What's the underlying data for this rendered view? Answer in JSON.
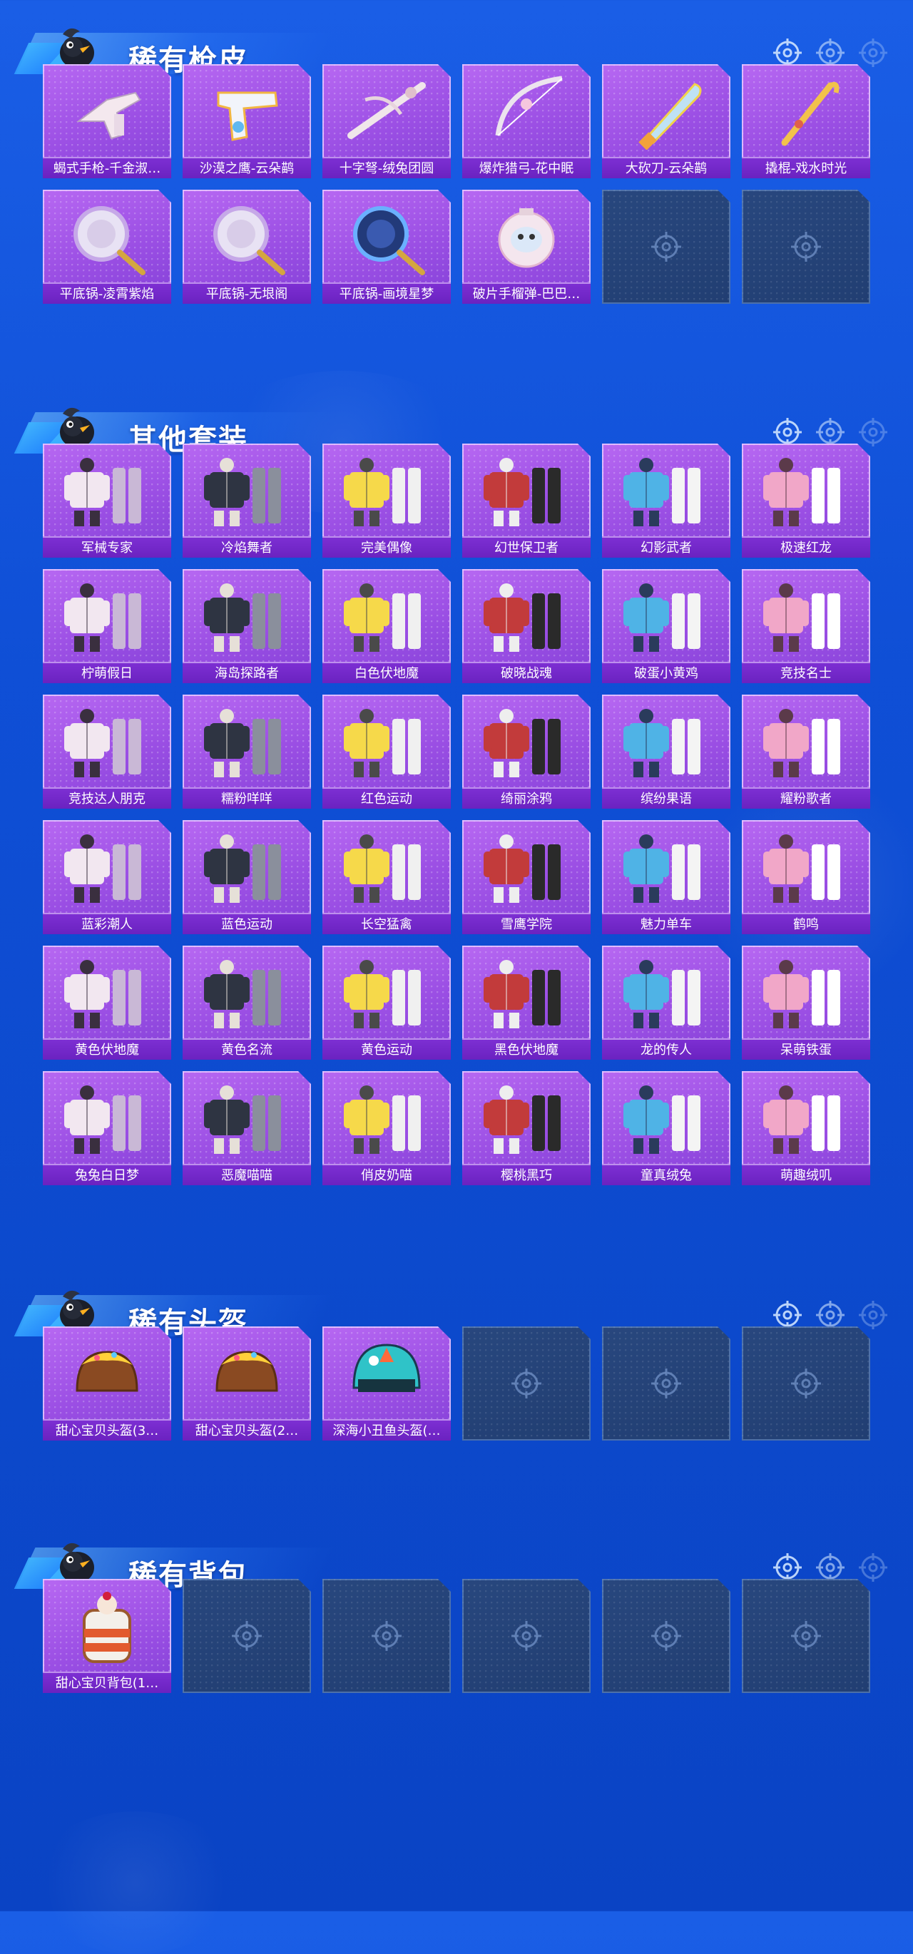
{
  "theme": {
    "accent": "#1a5ee6",
    "card_purple": "#9b4fe4",
    "label_purple": "#7d2fd3",
    "empty_slot": "#213e72"
  },
  "sections": [
    {
      "id": "rare-gun-skins",
      "title": "稀有枪皮",
      "items": [
        {
          "name": "蝎式手枪-千金淑…",
          "icon": "smg-icon"
        },
        {
          "name": "沙漠之鹰-云朵鹋",
          "icon": "pistol-icon"
        },
        {
          "name": "十字弩-绒兔团圆",
          "icon": "crossbow-icon"
        },
        {
          "name": "爆炸猎弓-花中眠",
          "icon": "bow-icon"
        },
        {
          "name": "大砍刀-云朵鹋",
          "icon": "machete-icon"
        },
        {
          "name": "撬棍-戏水时光",
          "icon": "crowbar-icon"
        },
        {
          "name": "平底锅-凌霄紫焰",
          "icon": "pan-icon"
        },
        {
          "name": "平底锅-无垠阁",
          "icon": "pan-icon"
        },
        {
          "name": "平底锅-画境星梦",
          "icon": "pan-icon"
        },
        {
          "name": "破片手榴弹-巴巴…",
          "icon": "grenade-icon"
        }
      ],
      "empty_slots": 2
    },
    {
      "id": "other-outfits",
      "title": "其他套装",
      "items": [
        {
          "name": "军械专家",
          "icon": "outfit-icon"
        },
        {
          "name": "冷焰舞者",
          "icon": "outfit-icon"
        },
        {
          "name": "完美偶像",
          "icon": "outfit-icon"
        },
        {
          "name": "幻世保卫者",
          "icon": "outfit-icon"
        },
        {
          "name": "幻影武者",
          "icon": "outfit-icon"
        },
        {
          "name": "极速红龙",
          "icon": "outfit-icon"
        },
        {
          "name": "柠萌假日",
          "icon": "outfit-icon"
        },
        {
          "name": "海岛探路者",
          "icon": "outfit-icon"
        },
        {
          "name": "白色伏地魔",
          "icon": "outfit-icon"
        },
        {
          "name": "破晓战魂",
          "icon": "outfit-icon"
        },
        {
          "name": "破蛋小黄鸡",
          "icon": "outfit-icon"
        },
        {
          "name": "竞技名士",
          "icon": "outfit-icon"
        },
        {
          "name": "竞技达人朋克",
          "icon": "outfit-icon"
        },
        {
          "name": "糯粉咩咩",
          "icon": "outfit-icon"
        },
        {
          "name": "红色运动",
          "icon": "outfit-icon"
        },
        {
          "name": "绮丽涂鸦",
          "icon": "outfit-icon"
        },
        {
          "name": "缤纷果语",
          "icon": "outfit-icon"
        },
        {
          "name": "耀粉歌者",
          "icon": "outfit-icon"
        },
        {
          "name": "蓝彩潮人",
          "icon": "outfit-icon"
        },
        {
          "name": "蓝色运动",
          "icon": "outfit-icon"
        },
        {
          "name": "长空猛禽",
          "icon": "outfit-icon"
        },
        {
          "name": "雪鹰学院",
          "icon": "outfit-icon"
        },
        {
          "name": "魅力单车",
          "icon": "outfit-icon"
        },
        {
          "name": "鹤鸣",
          "icon": "outfit-icon"
        },
        {
          "name": "黄色伏地魔",
          "icon": "outfit-icon"
        },
        {
          "name": "黄色名流",
          "icon": "outfit-icon"
        },
        {
          "name": "黄色运动",
          "icon": "outfit-icon"
        },
        {
          "name": "黑色伏地魔",
          "icon": "outfit-icon"
        },
        {
          "name": "龙的传人",
          "icon": "outfit-icon"
        },
        {
          "name": "呆萌铁蛋",
          "icon": "outfit-icon"
        },
        {
          "name": "兔兔白日梦",
          "icon": "outfit-icon"
        },
        {
          "name": "恶魔喵喵",
          "icon": "outfit-icon"
        },
        {
          "name": "俏皮奶喵",
          "icon": "outfit-icon"
        },
        {
          "name": "樱桃黑巧",
          "icon": "outfit-icon"
        },
        {
          "name": "童真绒兔",
          "icon": "outfit-icon"
        },
        {
          "name": "萌趣绒叽",
          "icon": "outfit-icon"
        }
      ],
      "empty_slots": 0
    },
    {
      "id": "rare-helmets",
      "title": "稀有头盔",
      "items": [
        {
          "name": "甜心宝贝头盔(3…",
          "icon": "helmet-icon"
        },
        {
          "name": "甜心宝贝头盔(2…",
          "icon": "helmet-icon"
        },
        {
          "name": "深海小丑鱼头盔(…",
          "icon": "helmet-icon"
        }
      ],
      "empty_slots": 3
    },
    {
      "id": "rare-backpacks",
      "title": "稀有背包",
      "items": [
        {
          "name": "甜心宝贝背包(1…",
          "icon": "backpack-icon"
        }
      ],
      "empty_slots": 5
    }
  ]
}
